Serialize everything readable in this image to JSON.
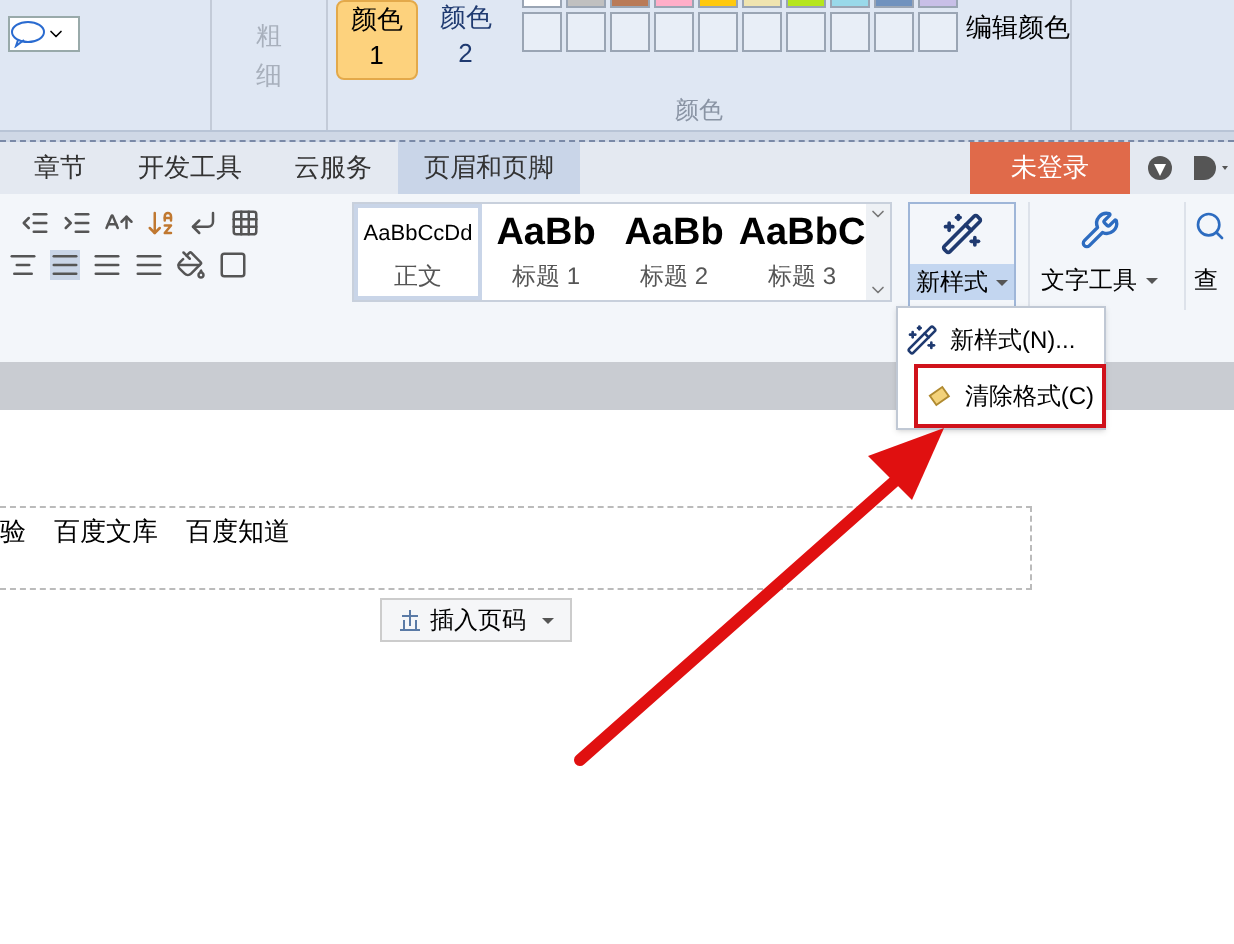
{
  "colors_group": {
    "label": "颜色",
    "weight": {
      "label": "粗细",
      "disabled": true
    },
    "color_buttons": [
      {
        "label": "颜色 1",
        "selected": true
      },
      {
        "label": "颜色 2",
        "selected": false
      }
    ],
    "swatches": [
      {
        "color": "#ffffff"
      },
      {
        "color": "#c0c0c0"
      },
      {
        "color": "#b97a57"
      },
      {
        "color": "#ffaec9"
      },
      {
        "color": "#ffc90e"
      },
      {
        "color": "#efe4b0"
      },
      {
        "color": "#b5e61d"
      },
      {
        "color": "#99d9ea"
      },
      {
        "color": "#7092be"
      },
      {
        "color": "#c8bfe7"
      }
    ],
    "edit_colors": "编辑颜色"
  },
  "tabs": [
    {
      "label": "章节",
      "selected": false
    },
    {
      "label": "开发工具",
      "selected": false
    },
    {
      "label": "云服务",
      "selected": false
    },
    {
      "label": "页眉和页脚",
      "selected": true
    }
  ],
  "login_button": "未登录",
  "styles": [
    {
      "sample": "AaBbCcDd",
      "label": "正文",
      "kind": "normal",
      "selected": true
    },
    {
      "sample": "AaBb",
      "label": "标题 1",
      "kind": "heading",
      "selected": false
    },
    {
      "sample": "AaBb",
      "label": "标题 2",
      "kind": "heading",
      "selected": false
    },
    {
      "sample": "AaBbC",
      "label": "标题 3",
      "kind": "heading",
      "selected": false
    }
  ],
  "new_style_button": {
    "label": "新样式",
    "expanded": true
  },
  "text_tools_button": "文字工具",
  "find_button": "查",
  "dropdown_menu": [
    {
      "label": "新样式(N)...",
      "kind": "new",
      "highlighted": false
    },
    {
      "label": "清除格式(C)",
      "kind": "clear",
      "highlighted": true
    }
  ],
  "header_text": [
    "验",
    "百度文库",
    "百度知道"
  ],
  "insert_page_number": "插入页码"
}
